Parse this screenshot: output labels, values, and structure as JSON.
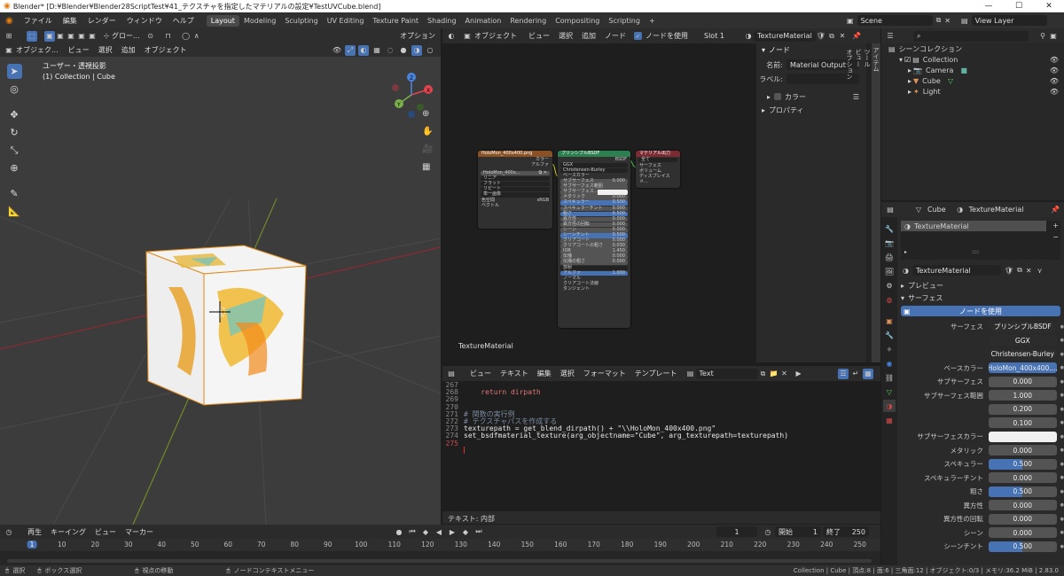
{
  "window": {
    "title": "Blender* [D:¥Blender¥Blender28ScriptTest¥41_テクスチャを指定したマテリアルの設定¥TestUVCube.blend]",
    "minimize": "—",
    "maximize": "☐",
    "close": "✕"
  },
  "menus": [
    "ファイル",
    "編集",
    "レンダー",
    "ウィンドウ",
    "ヘルプ"
  ],
  "workspaces": [
    "Layout",
    "Modeling",
    "Sculpting",
    "UV Editing",
    "Texture Paint",
    "Shading",
    "Animation",
    "Rendering",
    "Compositing",
    "Scripting"
  ],
  "active_workspace": "Layout",
  "scene": {
    "label": "Scene"
  },
  "viewlayer": {
    "label": "View Layer"
  },
  "viewport": {
    "mode": "オブジェク...",
    "menus": [
      "ビュー",
      "選択",
      "追加",
      "オブジェクト"
    ],
    "orientation": "グロー...",
    "options": "オプション",
    "overlay_title": "ユーザー・透視投影",
    "overlay_sub": "(1) Collection | Cube",
    "gizmo_axes": [
      "X",
      "Y",
      "Z"
    ]
  },
  "node_editor": {
    "mode": "オブジェクト",
    "menus": [
      "ビュー",
      "選択",
      "追加",
      "ノード"
    ],
    "use_nodes": "ノードを使用",
    "slot": "Slot 1",
    "material": "TextureMaterial",
    "corner_label": "TextureMaterial",
    "sidebar": {
      "section": "ノード",
      "name_label": "名前:",
      "name_value": "Material Output",
      "label_label": "ラベル:",
      "color": "カラー",
      "properties": "プロパティ"
    },
    "tabs": [
      "アイテム",
      "ツール",
      "ビュー",
      "オプション"
    ],
    "tex_node": {
      "title": "HoloMon_400x400.png",
      "out1": "カラー",
      "out2": "アルファ",
      "image": "HoloMon_400x...",
      "fields": [
        "リニア",
        "フラット",
        "リピート",
        "単一画像"
      ],
      "cs_label": "色空間",
      "cs_value": "sRGB",
      "vector": "ベクトル"
    },
    "bsdf_node": {
      "title": "プリンシプルBSDF",
      "out": "BSDF",
      "dist": "GGX",
      "sss": "Christensen-Burley",
      "inputs": [
        [
          "ベースカラー",
          "",
          ""
        ],
        [
          "サブサーフェス",
          "0.000",
          ""
        ],
        [
          "サブサーフェス範囲",
          "",
          ""
        ],
        [
          "サブサーフェス...",
          "",
          "white"
        ],
        [
          "メタリック",
          "0.000",
          ""
        ],
        [
          "スペキュラー",
          "0.500",
          "blue"
        ],
        [
          "スペキュラーチント",
          "0.000",
          ""
        ],
        [
          "粗さ",
          "0.500",
          "blue"
        ],
        [
          "異方性",
          "0.000",
          ""
        ],
        [
          "異方性の回転",
          "0.000",
          ""
        ],
        [
          "シーン",
          "0.000",
          ""
        ],
        [
          "シーンチント",
          "0.500",
          "blue"
        ],
        [
          "クリアコート",
          "0.000",
          ""
        ],
        [
          "クリアコートの粗さ",
          "0.030",
          ""
        ],
        [
          "IOR",
          "1.450",
          ""
        ],
        [
          "伝播",
          "0.000",
          ""
        ],
        [
          "伝播の粗さ",
          "0.000",
          ""
        ],
        [
          "放射",
          "",
          "dark"
        ],
        [
          "アルファ",
          "1.000",
          "blue"
        ],
        [
          "ノーマル",
          "",
          ""
        ],
        [
          "クリアコート法線",
          "",
          ""
        ],
        [
          "タンジェント",
          "",
          ""
        ]
      ]
    },
    "out_node": {
      "title": "マテリアル出力",
      "target": "全て",
      "rows": [
        "サーフェス",
        "ボリューム",
        "ディスプレイスメ..."
      ]
    }
  },
  "text_editor": {
    "menus": [
      "ビュー",
      "テキスト",
      "編集",
      "選択",
      "フォーマット",
      "テンプレート"
    ],
    "file": "Text",
    "footer": "テキスト: 内部",
    "lines": [
      [
        "267",
        ""
      ],
      [
        "268",
        "    return dirpath"
      ],
      [
        "269",
        ""
      ],
      [
        "270",
        ""
      ],
      [
        "271",
        "# 関数の実行例"
      ],
      [
        "272",
        "# テクスチャパスを作成する"
      ],
      [
        "273",
        "texturepath = get_blend_dirpath() + \"\\\\HoloMon_400x400.png\""
      ],
      [
        "274",
        "set_bsdfmaterial_texture(arg_objectname=\"Cube\", arg_texturepath=texturepath)"
      ],
      [
        "275",
        ""
      ]
    ]
  },
  "timeline": {
    "menus": [
      "再生",
      "キーイング",
      "ビュー",
      "マーカー"
    ],
    "current": "1",
    "start_label": "開始",
    "start": "1",
    "end_label": "終了",
    "end": "250",
    "ticks": [
      "1",
      "10",
      "20",
      "30",
      "40",
      "50",
      "60",
      "70",
      "80",
      "90",
      "100",
      "110",
      "120",
      "130",
      "140",
      "150",
      "160",
      "170",
      "180",
      "190",
      "200",
      "210",
      "220",
      "230",
      "240",
      "250"
    ]
  },
  "status": {
    "select": "選択",
    "box": "ボックス選択",
    "move": "視点の移動",
    "ctx": "ノードコンテキストメニュー",
    "info": "Collection | Cube | 頂点:8 | 面:6 | 三角面:12 | オブジェクト:0/3 | メモリ:36.2 MiB | 2.83.0"
  },
  "outliner": {
    "root": "シーンコレクション",
    "items": [
      [
        "Collection",
        ""
      ],
      [
        "Camera",
        ""
      ],
      [
        "Cube",
        ""
      ],
      [
        "Light",
        ""
      ]
    ]
  },
  "properties": {
    "obj": "Cube",
    "mat": "TextureMaterial",
    "slot": "TextureMaterial",
    "matfield": "TextureMaterial",
    "preview": "プレビュー",
    "surface": "サーフェス",
    "use_nodes": "ノードを使用",
    "rows": [
      [
        "サーフェス",
        "プリンシプルBSDF",
        "menu"
      ],
      [
        "",
        "GGX",
        "menu"
      ],
      [
        "",
        "Christensen-Burley",
        "menu"
      ],
      [
        "ベースカラー",
        "HoloMon_400x400....",
        "tex"
      ],
      [
        "サブサーフェス",
        "0.000",
        ""
      ],
      [
        "サブサーフェス範囲",
        "1.000",
        ""
      ],
      [
        "",
        "0.200",
        ""
      ],
      [
        "",
        "0.100",
        ""
      ],
      [
        "サブサーフェスカラー",
        "",
        "white"
      ],
      [
        "メタリック",
        "0.000",
        ""
      ],
      [
        "スペキュラー",
        "0.500",
        "half"
      ],
      [
        "スペキュラーチント",
        "0.000",
        ""
      ],
      [
        "粗さ",
        "0.500",
        "half"
      ],
      [
        "異方性",
        "0.000",
        ""
      ],
      [
        "異方性の回転",
        "0.000",
        ""
      ],
      [
        "シーン",
        "0.000",
        ""
      ],
      [
        "シーンチント",
        "0.500",
        "half"
      ]
    ]
  },
  "colors": {
    "accent": "#4772b3",
    "header": "#2b2b2b",
    "bg": "#1d1d1d"
  }
}
